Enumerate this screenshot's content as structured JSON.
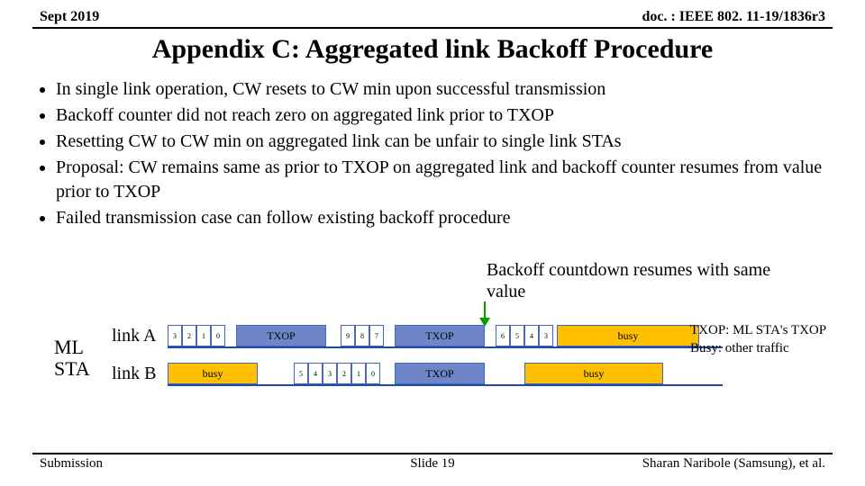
{
  "header": {
    "date": "Sept 2019",
    "doc": "doc. : IEEE 802. 11-19/1836r3"
  },
  "title": "Appendix C: Aggregated link Backoff Procedure",
  "bullets": [
    "In single link operation, CW resets to CW min upon successful transmission",
    "Backoff counter did not reach zero on aggregated link prior to TXOP",
    "Resetting CW to CW min on aggregated link can be unfair to single link STAs",
    "Proposal: CW remains same as prior to TXOP on aggregated link and backoff counter resumes from value prior to TXOP",
    "Failed transmission case can follow existing backoff procedure"
  ],
  "callout": "Backoff countdown resumes with same value",
  "diagram": {
    "ml_sta": "ML\nSTA",
    "lane_a_label": "link A",
    "lane_b_label": "link B",
    "txop_label": "TXOP",
    "busy_label": "busy",
    "a_slots1": [
      "3",
      "2",
      "1",
      "0"
    ],
    "a_slots2": [
      "9",
      "8",
      "7"
    ],
    "a_slots3": [
      "6",
      "5",
      "4",
      "3"
    ],
    "b_slots": [
      "5",
      "4",
      "3",
      "2",
      "1",
      "0"
    ]
  },
  "legend": {
    "line1": "TXOP: ML STA's TXOP",
    "line2": "Busy: other traffic"
  },
  "footer": {
    "left": "Submission",
    "center": "Slide 19",
    "right": "Sharan Naribole (Samsung), et al."
  }
}
